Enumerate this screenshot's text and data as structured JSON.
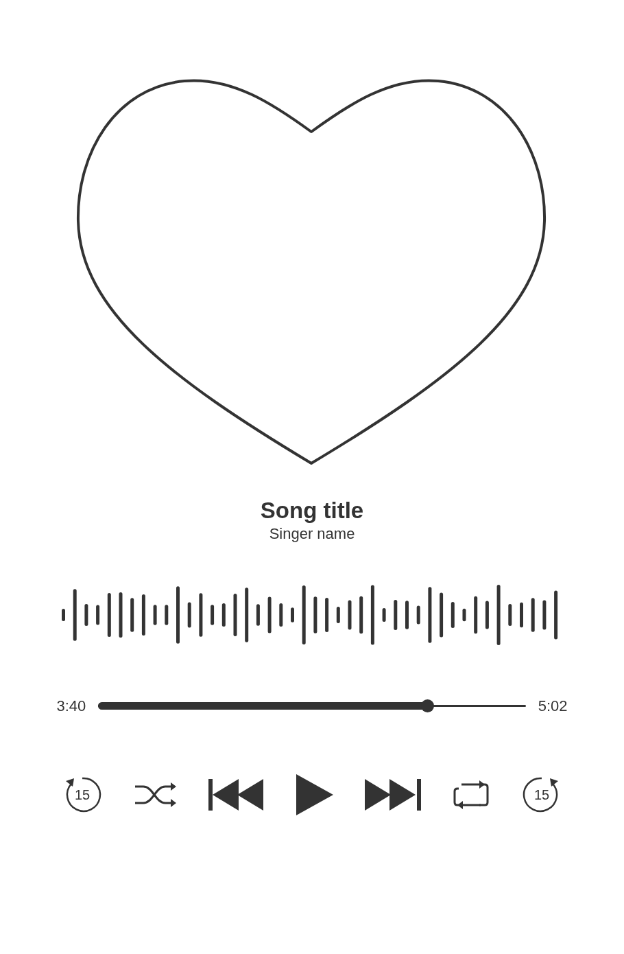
{
  "track": {
    "title": "Song title",
    "artist": "Singer name"
  },
  "progress": {
    "elapsed": "3:40",
    "total": "5:02",
    "level": 0.77
  },
  "controls": [
    {
      "kind": "replay",
      "label": "15"
    },
    {
      "kind": "shuffle"
    },
    {
      "kind": "previous"
    },
    {
      "kind": "play"
    },
    {
      "kind": "next"
    },
    {
      "kind": "repeat"
    },
    {
      "kind": "forward",
      "label": "15"
    }
  ]
}
